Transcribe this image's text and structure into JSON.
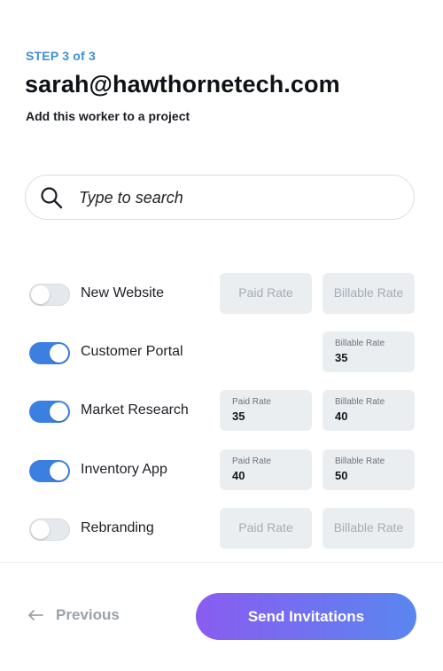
{
  "header": {
    "step": "STEP 3 of 3",
    "email": "sarah@hawthornetech.com",
    "subtitle": "Add this worker to a project"
  },
  "search": {
    "placeholder": "Type to search",
    "icon": "search-icon"
  },
  "rate_labels": {
    "paid_placeholder": "Paid Rate",
    "billable_placeholder": "Billable Rate",
    "paid_label": "Paid Rate",
    "billable_label": "Billable Rate"
  },
  "projects": [
    {
      "name": "New Website",
      "enabled": false,
      "paid_rate": "",
      "billable_rate": ""
    },
    {
      "name": "Customer Portal",
      "enabled": true,
      "paid_rate": null,
      "billable_rate": "35"
    },
    {
      "name": "Market Research",
      "enabled": true,
      "paid_rate": "35",
      "billable_rate": "40"
    },
    {
      "name": "Inventory App",
      "enabled": true,
      "paid_rate": "40",
      "billable_rate": "50"
    },
    {
      "name": "Rebranding",
      "enabled": false,
      "paid_rate": "",
      "billable_rate": ""
    }
  ],
  "footer": {
    "previous_label": "Previous",
    "send_label": "Send Invitations"
  },
  "colors": {
    "accent": "#3b7fe0",
    "step_text": "#3d8fd6",
    "toggle_off": "#e5e8ec",
    "rate_field": "#eaeef1",
    "button_gradient_start": "#8a5cf0",
    "button_gradient_end": "#5a86ef"
  }
}
